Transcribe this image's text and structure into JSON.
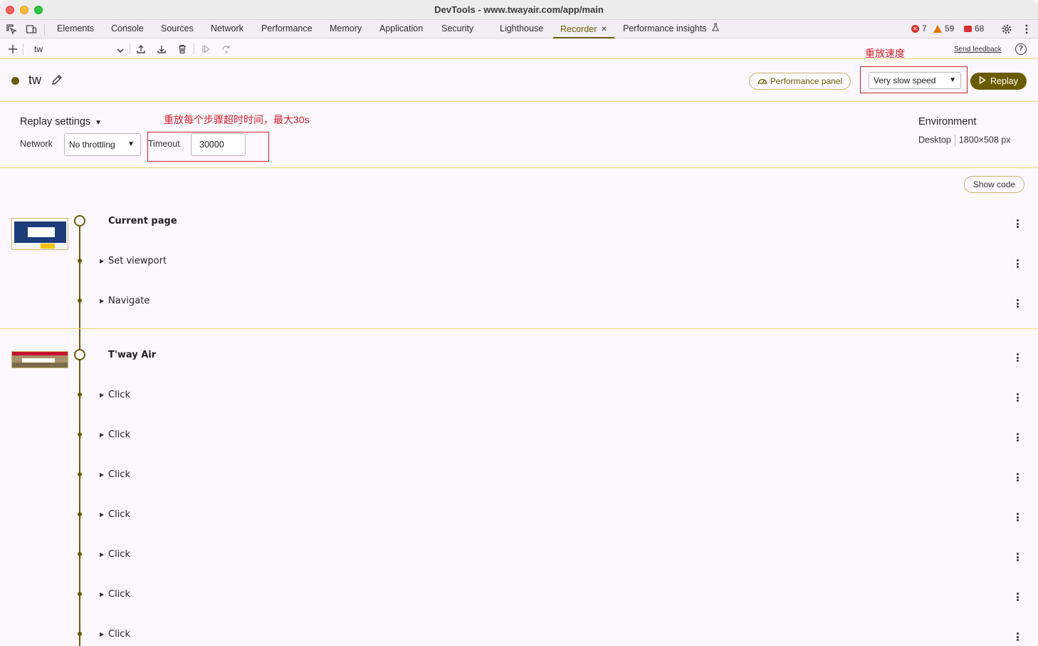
{
  "window": {
    "title": "DevTools - www.twayair.com/app/main"
  },
  "tabs": [
    {
      "label": "Elements"
    },
    {
      "label": "Console"
    },
    {
      "label": "Sources"
    },
    {
      "label": "Network"
    },
    {
      "label": "Performance"
    },
    {
      "label": "Memory"
    },
    {
      "label": "Application"
    },
    {
      "label": "Security"
    },
    {
      "label": "Lighthouse"
    },
    {
      "label": "Recorder",
      "active": true
    },
    {
      "label": "Performance insights"
    }
  ],
  "counts": {
    "errors": "7",
    "warnings": "59",
    "issues": "68"
  },
  "toolbar": {
    "recording_select": "tw",
    "send_feedback": "Send feedback"
  },
  "annotations": {
    "speed_note": "重放速度",
    "timeout_note": "重放每个步骤超时时间，最大30s"
  },
  "recording": {
    "name": "tw",
    "performance_panel_label": "Performance panel",
    "speed_value": "Very slow speed",
    "replay_label": "Replay"
  },
  "settings": {
    "title": "Replay settings",
    "network_label": "Network",
    "network_value": "No throttling",
    "timeout_label": "Timeout",
    "timeout_value": "30000",
    "environment_title": "Environment",
    "environment_device": "Desktop",
    "environment_size": "1800×508 px"
  },
  "show_code_label": "Show code",
  "sections": [
    {
      "title": "Current page",
      "steps": [
        "Set viewport",
        "Navigate"
      ]
    },
    {
      "title": "T'way Air",
      "steps": [
        "Click",
        "Click",
        "Click",
        "Click",
        "Click",
        "Click",
        "Click"
      ]
    }
  ],
  "colors": {
    "accent": "#6b5a00",
    "annotation": "#d4202c",
    "border": "#e8d87a"
  }
}
